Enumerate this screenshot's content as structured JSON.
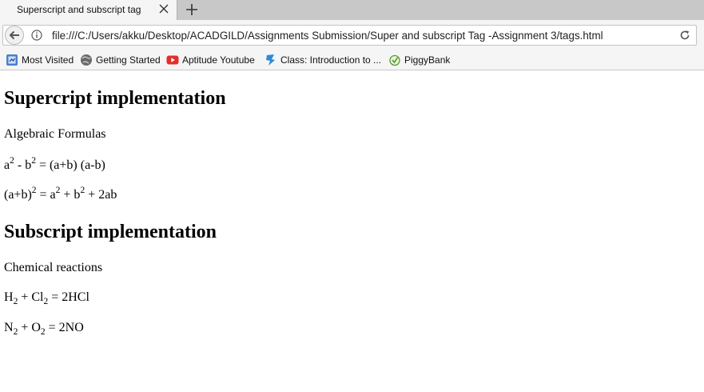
{
  "browser": {
    "tab_title": "Superscript and subscript tag",
    "url": "file:///C:/Users/akku/Desktop/ACADGILD/Assignments Submission/Super and subscript Tag -Assignment 3/tags.html"
  },
  "bookmarks": [
    {
      "label": "Most Visited",
      "icon": "most-visited-icon"
    },
    {
      "label": "Getting Started",
      "icon": "firefox-globe-icon"
    },
    {
      "label": "Aptitude Youtube",
      "icon": "youtube-icon"
    },
    {
      "label": "Class: Introduction to ...",
      "icon": "class-site-icon"
    },
    {
      "label": "PiggyBank",
      "icon": "piggybank-icon"
    }
  ],
  "page": {
    "superscript_heading": "Supercript implementation",
    "algebra_label": "Algebraic Formulas",
    "formula1": {
      "a": "a",
      "a_exp": "2",
      "minus_b": " - b",
      "b_exp": "2",
      "rest": " = (a+b) (a-b)"
    },
    "formula2": {
      "ab": "(a+b)",
      "ab_exp": "2",
      "eq_a": " = a",
      "a_exp": "2",
      "plus_b": " + b",
      "b_exp": "2",
      "rest": " + 2ab"
    },
    "subscript_heading": "Subscript implementation",
    "chem_label": "Chemical reactions",
    "reaction1": {
      "h": "H",
      "h_sub": "2",
      "plus_cl": " + Cl",
      "cl_sub": "2",
      "rest": " = 2HCl"
    },
    "reaction2": {
      "n": "N",
      "n_sub": "2",
      "plus_o": " + O",
      "o_sub": "2",
      "rest": " = 2NO"
    }
  }
}
